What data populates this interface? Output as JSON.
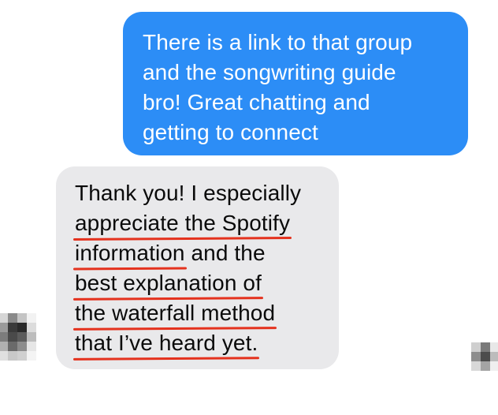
{
  "colors": {
    "outgoing_bg": "#2c8df6",
    "outgoing_text": "#ffffff",
    "incoming_bg": "#e9e9eb",
    "incoming_text": "#0a0a0a",
    "underline": "#e4321e"
  },
  "messages": [
    {
      "direction": "outgoing",
      "lines": [
        "There is a link to that group",
        "and the songwriting guide",
        "bro! Great chatting and",
        "getting to connect"
      ]
    },
    {
      "direction": "incoming",
      "line1": "Thank you! I especially",
      "line2_underlined": "appreciate the Spotify",
      "line3_underlined": "information",
      "line3_rest": " and the",
      "line4_underlined": "best explanation of",
      "line5_underlined": "the waterfall method",
      "line6_underlined": "that I’ve heard yet."
    }
  ],
  "avatars": [
    {
      "side": "left",
      "icon": "pixelated-avatar-icon"
    },
    {
      "side": "right",
      "icon": "pixelated-avatar-icon"
    }
  ]
}
